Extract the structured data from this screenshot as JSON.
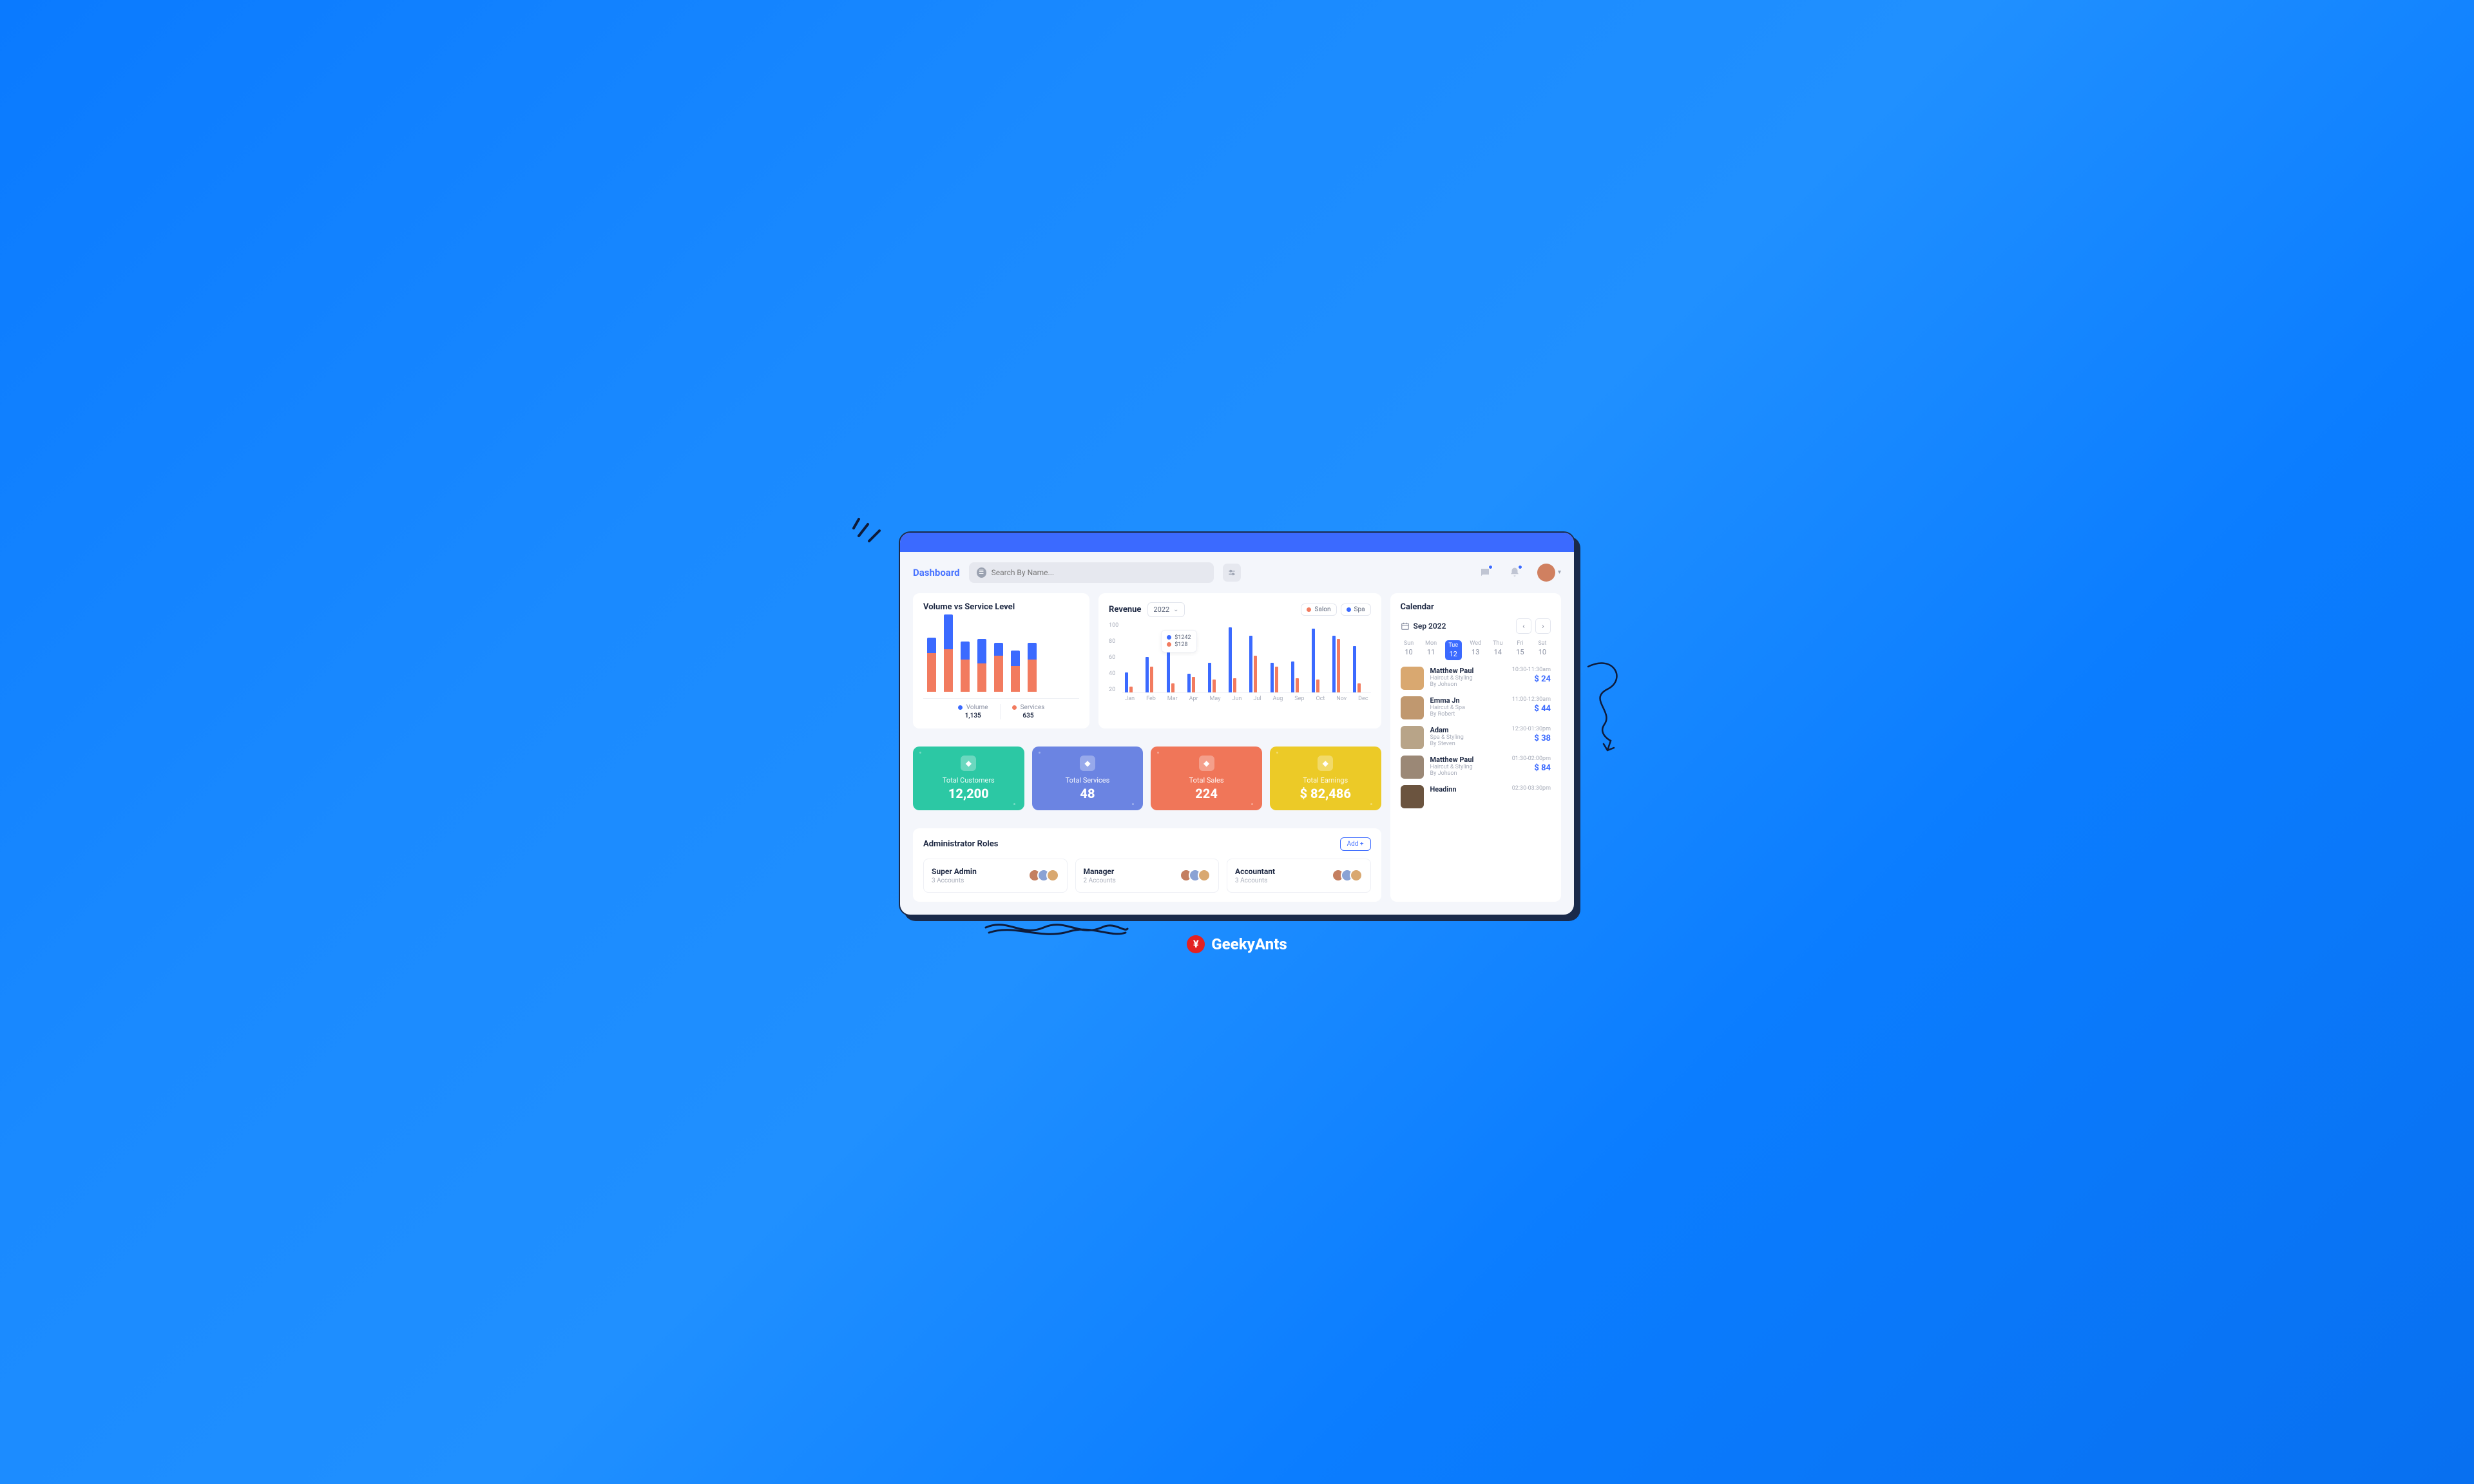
{
  "brand": "GeekyAnts",
  "header": {
    "title": "Dashboard",
    "search_placeholder": "Search By Name..."
  },
  "volume_card": {
    "title": "Volume vs Service Level",
    "legend": [
      {
        "label": "Volume",
        "value": "1,135",
        "color": "#3b6aff"
      },
      {
        "label": "Services",
        "value": "635",
        "color": "#f27b5f"
      }
    ]
  },
  "revenue_card": {
    "title": "Revenue",
    "year": "2022",
    "chips": [
      {
        "label": "Salon",
        "color": "#f27b5f"
      },
      {
        "label": "Spa",
        "color": "#3b6aff"
      }
    ],
    "tooltip": {
      "blue": "$1242",
      "orange": "$128"
    },
    "yticks": [
      "100",
      "80",
      "60",
      "40",
      "20"
    ]
  },
  "stats": [
    {
      "label": "Total Customers",
      "value": "12,200",
      "color": "#2cc8a4",
      "icon": "person-icon"
    },
    {
      "label": "Total Services",
      "value": "48",
      "color": "#6b84e2",
      "icon": "scissors-icon"
    },
    {
      "label": "Total Sales",
      "value": "224",
      "color": "#f07659",
      "icon": "chart-icon"
    },
    {
      "label": "Total Earnings",
      "value": "$ 82,486",
      "color": "#ecca27",
      "icon": "coin-icon"
    }
  ],
  "admin": {
    "title": "Administrator Roles",
    "add_label": "Add +",
    "roles": [
      {
        "name": "Super Admin",
        "count": "3 Accounts"
      },
      {
        "name": "Manager",
        "count": "2 Accounts"
      },
      {
        "name": "Accountant",
        "count": "3 Accounts"
      }
    ]
  },
  "calendar": {
    "title": "Calendar",
    "month": "Sep 2022",
    "days": [
      {
        "w": "Sun",
        "n": "10"
      },
      {
        "w": "Mon",
        "n": "11"
      },
      {
        "w": "Tue",
        "n": "12",
        "active": true
      },
      {
        "w": "Wed",
        "n": "13"
      },
      {
        "w": "Thu",
        "n": "14"
      },
      {
        "w": "Fri",
        "n": "15"
      },
      {
        "w": "Sat",
        "n": "10"
      }
    ],
    "appts": [
      {
        "name": "Matthew Paul",
        "svc": "Haircut & Styling",
        "by": "By Johson",
        "time": "10:30-11:30am",
        "price": "$ 24",
        "c": "c1"
      },
      {
        "name": "Emma Jn",
        "svc": "Haircut & Spa",
        "by": "By Robert",
        "time": "11:00-12:30am",
        "price": "$ 44",
        "c": "c2"
      },
      {
        "name": "Adam",
        "svc": "Spa & Styling",
        "by": "By Steven",
        "time": "12:30-01:30pm",
        "price": "$ 38",
        "c": "c3"
      },
      {
        "name": "Matthew Paul",
        "svc": "Haircut & Styling",
        "by": "By Johson",
        "time": "01:30-02:00pm",
        "price": "$ 84",
        "c": "c4"
      },
      {
        "name": "Headinn",
        "svc": "",
        "by": "",
        "time": "02:30-03:30pm",
        "price": "",
        "c": "c5"
      }
    ]
  },
  "chart_data": [
    {
      "type": "bar",
      "title": "Volume vs Service Level",
      "series": [
        {
          "name": "Services",
          "color": "#f27b5f",
          "values": [
            60,
            66,
            50,
            44,
            56,
            40,
            50
          ]
        },
        {
          "name": "Volume",
          "color": "#3b6aff",
          "values": [
            24,
            54,
            28,
            38,
            20,
            24,
            26
          ]
        }
      ],
      "totals": {
        "Volume": 1135,
        "Services": 635
      }
    },
    {
      "type": "bar",
      "title": "Revenue",
      "xlabel": "",
      "ylabel": "",
      "ylim": [
        0,
        100
      ],
      "categories": [
        "Jan",
        "Feb",
        "Mar",
        "Apr",
        "May",
        "Jun",
        "Jul",
        "Aug",
        "Sep",
        "Oct",
        "Nov",
        "Dec"
      ],
      "series": [
        {
          "name": "Spa",
          "color": "#3b6aff",
          "values": [
            28,
            50,
            62,
            26,
            42,
            92,
            80,
            42,
            44,
            90,
            80,
            66
          ]
        },
        {
          "name": "Salon",
          "color": "#f27b5f",
          "values": [
            8,
            36,
            12,
            22,
            18,
            20,
            52,
            36,
            20,
            18,
            76,
            12
          ]
        }
      ],
      "tooltip": {
        "Spa": "$1242",
        "Salon": "$128"
      }
    }
  ]
}
